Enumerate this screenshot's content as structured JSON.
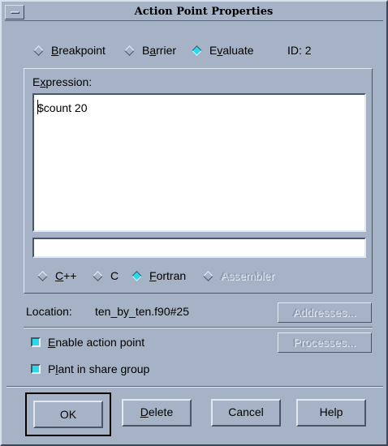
{
  "window": {
    "title": "Action Point Properties"
  },
  "type_radios": [
    {
      "mnemonic": "B",
      "rest": "reakpoint",
      "selected": false
    },
    {
      "pre": "B",
      "mnemonic": "a",
      "rest": "rrier",
      "selected": false
    },
    {
      "pre": "E",
      "mnemonic": "v",
      "rest": "aluate",
      "selected": true
    }
  ],
  "id_label": "ID: 2",
  "expression": {
    "label_pre": "E",
    "label_mnemonic": "x",
    "label_rest": "pression:",
    "text": "$count 20",
    "secondary_value": ""
  },
  "languages": [
    {
      "mnemonic": "C",
      "rest": "++",
      "selected": false,
      "enabled": true
    },
    {
      "label": "C",
      "selected": false,
      "enabled": true
    },
    {
      "mnemonic": "F",
      "rest": "ortran",
      "selected": true,
      "enabled": true
    },
    {
      "label": "Assembler",
      "selected": false,
      "enabled": false
    }
  ],
  "location": {
    "label": "Location:",
    "value": "ten_by_ten.f90#25"
  },
  "buttons": {
    "addresses": "Addresses...",
    "processes": "Processes...",
    "ok": "OK",
    "delete_mnemonic": "D",
    "delete_rest": "elete",
    "cancel": "Cancel",
    "help": "Help"
  },
  "checkboxes": {
    "enable": {
      "mnemonic": "E",
      "rest": "nable action point",
      "checked": true
    },
    "plant": {
      "pre": "P",
      "mnemonic": "l",
      "rest": "ant in share group",
      "checked": true
    }
  },
  "colors": {
    "background": "#a6b2c6",
    "selected": "#2ed8ec"
  }
}
